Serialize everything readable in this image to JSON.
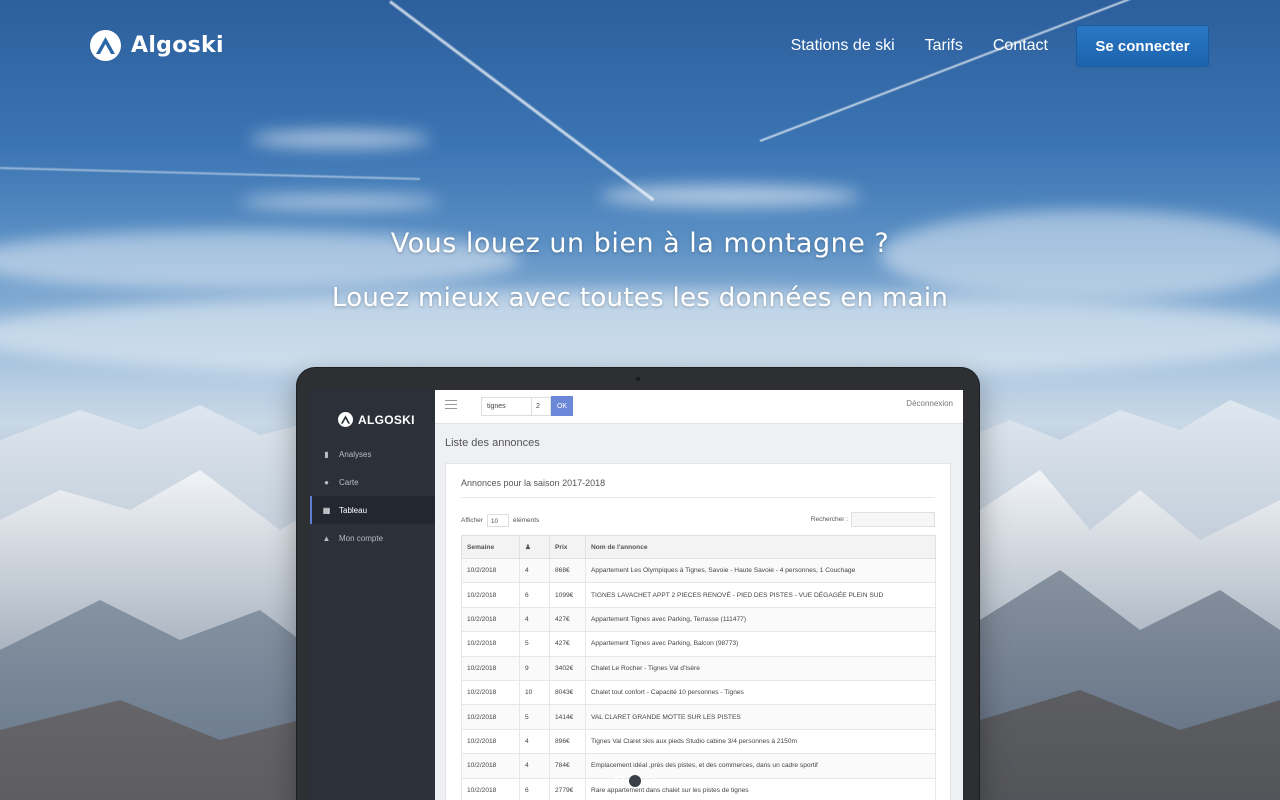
{
  "brand": {
    "name": "Algoski"
  },
  "nav": {
    "links": [
      "Stations de ski",
      "Tarifs",
      "Contact"
    ],
    "cta_label": "Se connecter"
  },
  "hero": {
    "title": "Vous louez un bien à la montagne ?",
    "subtitle": "Louez mieux avec toutes les données en main"
  },
  "app": {
    "brand": "ALGOSKI",
    "sidebar": [
      {
        "label": "Analyses",
        "icon": "bar-chart-icon"
      },
      {
        "label": "Carte",
        "icon": "map-pin-icon"
      },
      {
        "label": "Tableau",
        "icon": "grid-icon"
      },
      {
        "label": "Mon compte",
        "icon": "user-icon"
      }
    ],
    "active_item": "Tableau",
    "station_select": "tignes",
    "count_select": "2",
    "ok_label": "OK",
    "logout": "Déconnexion",
    "page_title": "Liste des annonces",
    "panel_title": "Annonces pour la saison 2017-2018",
    "show_prefix": "Afficher",
    "show_value": "10",
    "show_suffix": "éléments",
    "search_label": "Rechercher :",
    "columns": [
      "Semaine",
      "",
      "Prix",
      "Nom de l'annonce"
    ],
    "rows": [
      [
        "10/2/2018",
        "4",
        "868€",
        "Appartement Les Olympiques à Tignes, Savoie - Haute Savoie - 4 personnes, 1 Couchage"
      ],
      [
        "10/2/2018",
        "6",
        "1099€",
        "TIGNES LAVACHET APPT 2 PIECES RENOVÉ - PIED DES PISTES - VUE DÉGAGÉE PLEIN SUD"
      ],
      [
        "10/2/2018",
        "4",
        "427€",
        "Appartement Tignes avec Parking, Terrasse (111477)"
      ],
      [
        "10/2/2018",
        "5",
        "427€",
        "Appartement Tignes avec Parking, Balcon (98773)"
      ],
      [
        "10/2/2018",
        "9",
        "3402€",
        "Chalet Le Rocher - Tignes Val d'Isère"
      ],
      [
        "10/2/2018",
        "10",
        "8043€",
        "Chalet tout confort - Capacité 10 personnes - Tignes"
      ],
      [
        "10/2/2018",
        "5",
        "1414€",
        "VAL CLARET GRANDE MOTTE SUR LES PISTES"
      ],
      [
        "10/2/2018",
        "4",
        "896€",
        "Tignes Val Claret skis aux pieds Studio cabine 3/4 personnes à 2150m"
      ],
      [
        "10/2/2018",
        "4",
        "784€",
        "Emplacement idéal ,près des pistes, et des commerces, dans un cadre sportif"
      ],
      [
        "10/2/2018",
        "6",
        "2779€",
        "Rare appartement dans chalet sur les pistes de tignes"
      ]
    ]
  },
  "carousel": {
    "count": 3,
    "active": 2
  }
}
